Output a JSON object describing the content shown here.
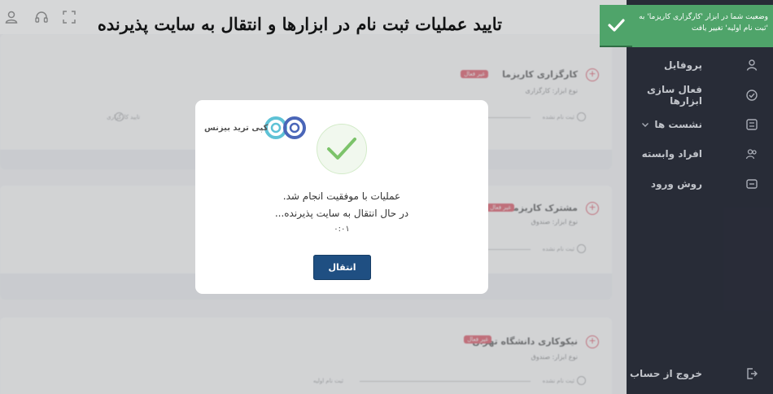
{
  "headline": "تایید عملیات ثبت نام در ابزارها و انتقال به سایت پذیرنده",
  "sidebar": {
    "items": [
      {
        "label": "پروفایل",
        "icon": "user-icon"
      },
      {
        "label": "فعال سازی ابزارها",
        "icon": "activate-icon"
      },
      {
        "label": "نشست ها",
        "icon": "sessions-icon"
      },
      {
        "label": "افراد وابسته",
        "icon": "users-icon"
      },
      {
        "label": "روش ورود",
        "icon": "login-method-icon"
      }
    ],
    "logout": "خروج از حساب"
  },
  "cards": [
    {
      "title": "کارگزاری کاریزما",
      "badge": "غیر فعال",
      "type": "نوع ابزار: کارگزاری",
      "step1": "ثبت نام نشده",
      "step2": "تایید کارگزاری"
    },
    {
      "title": "مشترک کاریزما",
      "badge": "غیر فعال",
      "type": "نوع ابزار: صندوق",
      "step1": "ثبت نام نشده",
      "step2": ""
    },
    {
      "title": "نیکوکاری دانشگاه تهران",
      "badge": "غیر فعال",
      "type": "نوع ابزار: صندوق",
      "step1": "ثبت نام نشده",
      "step2": "ثبت نام اولیه"
    }
  ],
  "modal": {
    "logo_text": "کپی ترید بیزنس",
    "line1": "عملیات با موفقیت انجام شد.",
    "line2": "در حال انتقال به سایت پذیرنده...",
    "timer": "۰:۰۱",
    "button": "انتقال"
  },
  "toast": {
    "text": "وضعیت شما در ابزار 'کارگزاری کاریزما' به 'ثبت نام اولیه' تغییر یافت"
  },
  "colors": {
    "sidebar": "#2b2f3b",
    "primary_button": "#1f4f82",
    "toast": "#4fa46a",
    "badge": "#d8263a",
    "success": "#7cc36a"
  }
}
